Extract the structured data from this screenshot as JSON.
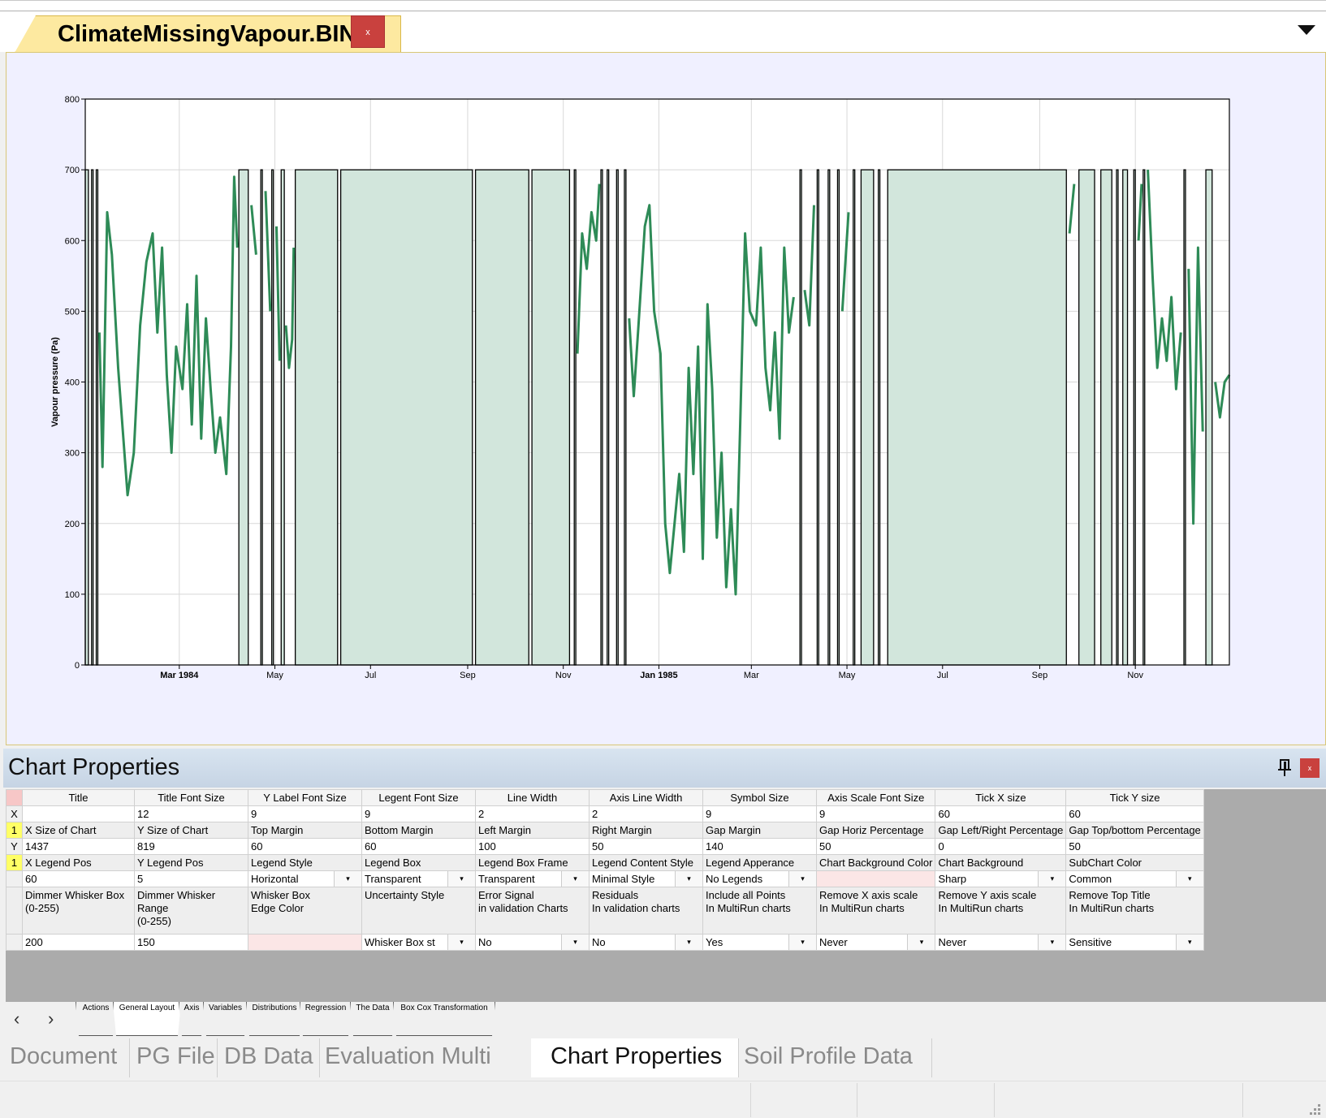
{
  "document": {
    "tab_title": "ClimateMissingVapour.BIN",
    "close_label": "x"
  },
  "chart_data": {
    "type": "line",
    "title": "",
    "xlabel": "",
    "ylabel": "Vapour pressure (Pa)",
    "ylim": [
      0,
      800
    ],
    "yticks": [
      0,
      100,
      200,
      300,
      400,
      500,
      600,
      700,
      800
    ],
    "xlim": [
      "1984-01-01",
      "1985-12-31"
    ],
    "xticks": [
      {
        "date": "1984-03-01",
        "label": "Mar 1984",
        "major": true
      },
      {
        "date": "1984-05-01",
        "label": "May",
        "major": false
      },
      {
        "date": "1984-07-01",
        "label": "Jul",
        "major": false
      },
      {
        "date": "1984-09-01",
        "label": "Sep",
        "major": false
      },
      {
        "date": "1984-11-01",
        "label": "Nov",
        "major": false
      },
      {
        "date": "1985-01-01",
        "label": "Jan 1985",
        "major": true
      },
      {
        "date": "1985-03-01",
        "label": "Mar",
        "major": false
      },
      {
        "date": "1985-05-01",
        "label": "May",
        "major": false
      },
      {
        "date": "1985-07-01",
        "label": "Jul",
        "major": false
      },
      {
        "date": "1985-09-01",
        "label": "Sep",
        "major": false
      },
      {
        "date": "1985-11-01",
        "label": "Nov",
        "major": false
      }
    ],
    "grid": true,
    "missing_marker_value": 700,
    "missing_color": "#d2e6dc",
    "line_color": "#2e8b57",
    "missing_periods": [
      [
        "1984-01-01",
        "1984-01-03"
      ],
      [
        "1984-01-05",
        "1984-01-06"
      ],
      [
        "1984-01-08",
        "1984-01-09"
      ],
      [
        "1984-04-08",
        "1984-04-14"
      ],
      [
        "1984-04-22",
        "1984-04-23"
      ],
      [
        "1984-04-29",
        "1984-04-30"
      ],
      [
        "1984-05-05",
        "1984-05-07"
      ],
      [
        "1984-05-14",
        "1984-06-10"
      ],
      [
        "1984-06-12",
        "1984-09-04"
      ],
      [
        "1984-09-06",
        "1984-10-10"
      ],
      [
        "1984-10-12",
        "1984-11-05"
      ],
      [
        "1984-11-08",
        "1984-11-09"
      ],
      [
        "1984-11-25",
        "1984-11-26"
      ],
      [
        "1984-11-29",
        "1984-11-30"
      ],
      [
        "1984-12-05",
        "1984-12-06"
      ],
      [
        "1984-12-10",
        "1984-12-11"
      ],
      [
        "1985-04-01",
        "1985-04-02"
      ],
      [
        "1985-04-12",
        "1985-04-13"
      ],
      [
        "1985-04-19",
        "1985-04-20"
      ],
      [
        "1985-04-25",
        "1985-04-26"
      ],
      [
        "1985-05-05",
        "1985-05-06"
      ],
      [
        "1985-05-10",
        "1985-05-18"
      ],
      [
        "1985-05-21",
        "1985-05-22"
      ],
      [
        "1985-05-27",
        "1985-09-18"
      ],
      [
        "1985-09-26",
        "1985-10-06"
      ],
      [
        "1985-10-10",
        "1985-10-17"
      ],
      [
        "1985-10-20",
        "1985-10-21"
      ],
      [
        "1985-10-24",
        "1985-10-27"
      ],
      [
        "1985-10-31",
        "1985-11-01"
      ],
      [
        "1985-11-06",
        "1985-11-07"
      ],
      [
        "1985-12-02",
        "1985-12-03"
      ],
      [
        "1985-12-16",
        "1985-12-20"
      ]
    ],
    "series": [
      {
        "values": [
          {
            "date": "1984-01-04",
            "value": 530
          },
          {
            "date": "1984-01-07",
            "value": 440
          },
          {
            "date": "1984-01-10",
            "value": 470
          },
          {
            "date": "1984-01-12",
            "value": 280
          },
          {
            "date": "1984-01-15",
            "value": 640
          },
          {
            "date": "1984-01-18",
            "value": 580
          },
          {
            "date": "1984-01-22",
            "value": 420
          },
          {
            "date": "1984-01-25",
            "value": 330
          },
          {
            "date": "1984-01-28",
            "value": 240
          },
          {
            "date": "1984-02-01",
            "value": 300
          },
          {
            "date": "1984-02-05",
            "value": 480
          },
          {
            "date": "1984-02-09",
            "value": 570
          },
          {
            "date": "1984-02-13",
            "value": 610
          },
          {
            "date": "1984-02-16",
            "value": 470
          },
          {
            "date": "1984-02-19",
            "value": 590
          },
          {
            "date": "1984-02-22",
            "value": 410
          },
          {
            "date": "1984-02-25",
            "value": 300
          },
          {
            "date": "1984-02-28",
            "value": 450
          },
          {
            "date": "1984-03-03",
            "value": 390
          },
          {
            "date": "1984-03-06",
            "value": 510
          },
          {
            "date": "1984-03-09",
            "value": 340
          },
          {
            "date": "1984-03-12",
            "value": 550
          },
          {
            "date": "1984-03-15",
            "value": 320
          },
          {
            "date": "1984-03-18",
            "value": 490
          },
          {
            "date": "1984-03-21",
            "value": 390
          },
          {
            "date": "1984-03-24",
            "value": 300
          },
          {
            "date": "1984-03-27",
            "value": 350
          },
          {
            "date": "1984-03-31",
            "value": 270
          },
          {
            "date": "1984-04-03",
            "value": 450
          },
          {
            "date": "1984-04-05",
            "value": 690
          },
          {
            "date": "1984-04-07",
            "value": 590
          },
          {
            "date": "1984-04-16",
            "value": 650
          },
          {
            "date": "1984-04-19",
            "value": 580
          },
          {
            "date": "1984-04-25",
            "value": 670
          },
          {
            "date": "1984-04-28",
            "value": 500
          },
          {
            "date": "1984-05-02",
            "value": 620
          },
          {
            "date": "1984-05-04",
            "value": 430
          },
          {
            "date": "1984-05-08",
            "value": 480
          },
          {
            "date": "1984-05-10",
            "value": 420
          },
          {
            "date": "1984-05-12",
            "value": 460
          },
          {
            "date": "1984-05-13",
            "value": 590
          },
          {
            "date": "1984-09-05",
            "value": 670
          },
          {
            "date": "1984-11-06",
            "value": 680
          },
          {
            "date": "1984-11-10",
            "value": 440
          },
          {
            "date": "1984-11-13",
            "value": 610
          },
          {
            "date": "1984-11-16",
            "value": 560
          },
          {
            "date": "1984-11-19",
            "value": 640
          },
          {
            "date": "1984-11-22",
            "value": 600
          },
          {
            "date": "1984-11-24",
            "value": 680
          },
          {
            "date": "1984-11-27",
            "value": 630
          },
          {
            "date": "1984-12-02",
            "value": 650
          },
          {
            "date": "1984-12-08",
            "value": 610
          },
          {
            "date": "1984-12-13",
            "value": 490
          },
          {
            "date": "1984-12-16",
            "value": 380
          },
          {
            "date": "1984-12-19",
            "value": 480
          },
          {
            "date": "1984-12-23",
            "value": 620
          },
          {
            "date": "1984-12-26",
            "value": 650
          },
          {
            "date": "1984-12-29",
            "value": 500
          },
          {
            "date": "1985-01-02",
            "value": 440
          },
          {
            "date": "1985-01-05",
            "value": 200
          },
          {
            "date": "1985-01-08",
            "value": 130
          },
          {
            "date": "1985-01-11",
            "value": 200
          },
          {
            "date": "1985-01-14",
            "value": 270
          },
          {
            "date": "1985-01-17",
            "value": 160
          },
          {
            "date": "1985-01-20",
            "value": 420
          },
          {
            "date": "1985-01-23",
            "value": 270
          },
          {
            "date": "1985-01-26",
            "value": 450
          },
          {
            "date": "1985-01-29",
            "value": 150
          },
          {
            "date": "1985-02-01",
            "value": 510
          },
          {
            "date": "1985-02-04",
            "value": 390
          },
          {
            "date": "1985-02-07",
            "value": 180
          },
          {
            "date": "1985-02-10",
            "value": 300
          },
          {
            "date": "1985-02-13",
            "value": 110
          },
          {
            "date": "1985-02-16",
            "value": 220
          },
          {
            "date": "1985-02-19",
            "value": 100
          },
          {
            "date": "1985-02-22",
            "value": 350
          },
          {
            "date": "1985-02-25",
            "value": 610
          },
          {
            "date": "1985-02-28",
            "value": 500
          },
          {
            "date": "1985-03-04",
            "value": 480
          },
          {
            "date": "1985-03-07",
            "value": 590
          },
          {
            "date": "1985-03-10",
            "value": 420
          },
          {
            "date": "1985-03-13",
            "value": 360
          },
          {
            "date": "1985-03-16",
            "value": 470
          },
          {
            "date": "1985-03-19",
            "value": 320
          },
          {
            "date": "1985-03-22",
            "value": 590
          },
          {
            "date": "1985-03-25",
            "value": 470
          },
          {
            "date": "1985-03-28",
            "value": 520
          },
          {
            "date": "1985-04-04",
            "value": 530
          },
          {
            "date": "1985-04-07",
            "value": 480
          },
          {
            "date": "1985-04-10",
            "value": 650
          },
          {
            "date": "1985-04-15",
            "value": 690
          },
          {
            "date": "1985-04-22",
            "value": 640
          },
          {
            "date": "1985-04-28",
            "value": 500
          },
          {
            "date": "1985-05-02",
            "value": 640
          },
          {
            "date": "1985-05-08",
            "value": 660
          },
          {
            "date": "1985-05-19",
            "value": 680
          },
          {
            "date": "1985-05-24",
            "value": 690
          },
          {
            "date": "1985-09-20",
            "value": 610
          },
          {
            "date": "1985-09-23",
            "value": 680
          },
          {
            "date": "1985-10-08",
            "value": 610
          },
          {
            "date": "1985-10-18",
            "value": 620
          },
          {
            "date": "1985-10-22",
            "value": 450
          },
          {
            "date": "1985-10-29",
            "value": 650
          },
          {
            "date": "1985-11-03",
            "value": 600
          },
          {
            "date": "1985-11-05",
            "value": 680
          },
          {
            "date": "1985-11-09",
            "value": 700
          },
          {
            "date": "1985-11-12",
            "value": 550
          },
          {
            "date": "1985-11-15",
            "value": 420
          },
          {
            "date": "1985-11-18",
            "value": 490
          },
          {
            "date": "1985-11-21",
            "value": 430
          },
          {
            "date": "1985-11-24",
            "value": 520
          },
          {
            "date": "1985-11-27",
            "value": 390
          },
          {
            "date": "1985-11-30",
            "value": 470
          },
          {
            "date": "1985-12-05",
            "value": 560
          },
          {
            "date": "1985-12-08",
            "value": 200
          },
          {
            "date": "1985-12-11",
            "value": 590
          },
          {
            "date": "1985-12-14",
            "value": 330
          },
          {
            "date": "1985-12-22",
            "value": 400
          },
          {
            "date": "1985-12-25",
            "value": 350
          },
          {
            "date": "1985-12-28",
            "value": 400
          },
          {
            "date": "1985-12-31",
            "value": 410
          }
        ]
      }
    ]
  },
  "properties_pane": {
    "title": "Chart Properties",
    "close_label": "x",
    "columns": [
      "Title",
      "Title Font Size",
      "Y Label Font Size",
      "Legent Font Size",
      "Line Width",
      "Axis Line Width",
      "Symbol Size",
      "Axis Scale Font Size",
      "Tick X size",
      "Tick Y size"
    ],
    "row_headers": [
      "",
      "X",
      "1",
      "Y",
      "1",
      "",
      "",
      ""
    ],
    "rows": [
      [
        "",
        "12",
        "9",
        "9",
        "2",
        "2",
        "9",
        "9",
        "60",
        "60"
      ],
      [
        "X Size of Chart",
        "Y Size of Chart",
        "Top Margin",
        "Bottom Margin",
        "Left Margin",
        "Right Margin",
        "Gap Margin",
        "Gap Horiz Percentage",
        "Gap Left/Right Percentage",
        "Gap Top/bottom Percentage"
      ],
      [
        "1437",
        "819",
        "60",
        "60",
        "100",
        "50",
        "140",
        "50",
        "0",
        "50"
      ],
      [
        "X Legend Pos",
        "Y Legend Pos",
        "Legend Style",
        "Legend Box",
        "Legend Box Frame",
        "Legend Content Style",
        "Legend Apperance",
        "Chart Background Color",
        "Chart Background",
        "SubChart Color"
      ],
      [
        "60",
        "5",
        "Horizontal",
        "Transparent",
        "Transparent",
        "Minimal Style",
        "No Legends",
        "",
        "Sharp",
        "Common"
      ],
      [
        "Dimmer Whisker Box\n(0-255)",
        "Dimmer Whisker\nRange\n(0-255)",
        "Whisker Box\n Edge Color",
        "Uncertainty Style",
        "Error Signal\nin validation Charts",
        "Residuals\nIn validation charts",
        "Include all Points\nIn MultiRun charts",
        "Remove X axis scale\n In MultiRun charts",
        "Remove Y axis scale\n In MultiRun charts",
        "Remove Top Title\n In MultiRun charts"
      ],
      [
        "200",
        "150",
        "",
        "Whisker Box st",
        "No",
        "No",
        "Yes",
        "Never",
        "Never",
        "Sensitive"
      ]
    ],
    "dropdown_arrow": "▾"
  },
  "sheet_tabs": {
    "prev": "‹",
    "next": "›",
    "items": [
      "Actions",
      "General Layout",
      "Axis",
      "Variables",
      "Distributions",
      "Regression",
      "The Data",
      "Box Cox Transformation"
    ],
    "active": "General Layout"
  },
  "panel_tabs": {
    "items": [
      "Document",
      "PG File",
      "DB Data",
      "Evaluation Multi",
      "Chart Properties",
      "Soil Profile Data"
    ],
    "active": "Chart Properties"
  }
}
